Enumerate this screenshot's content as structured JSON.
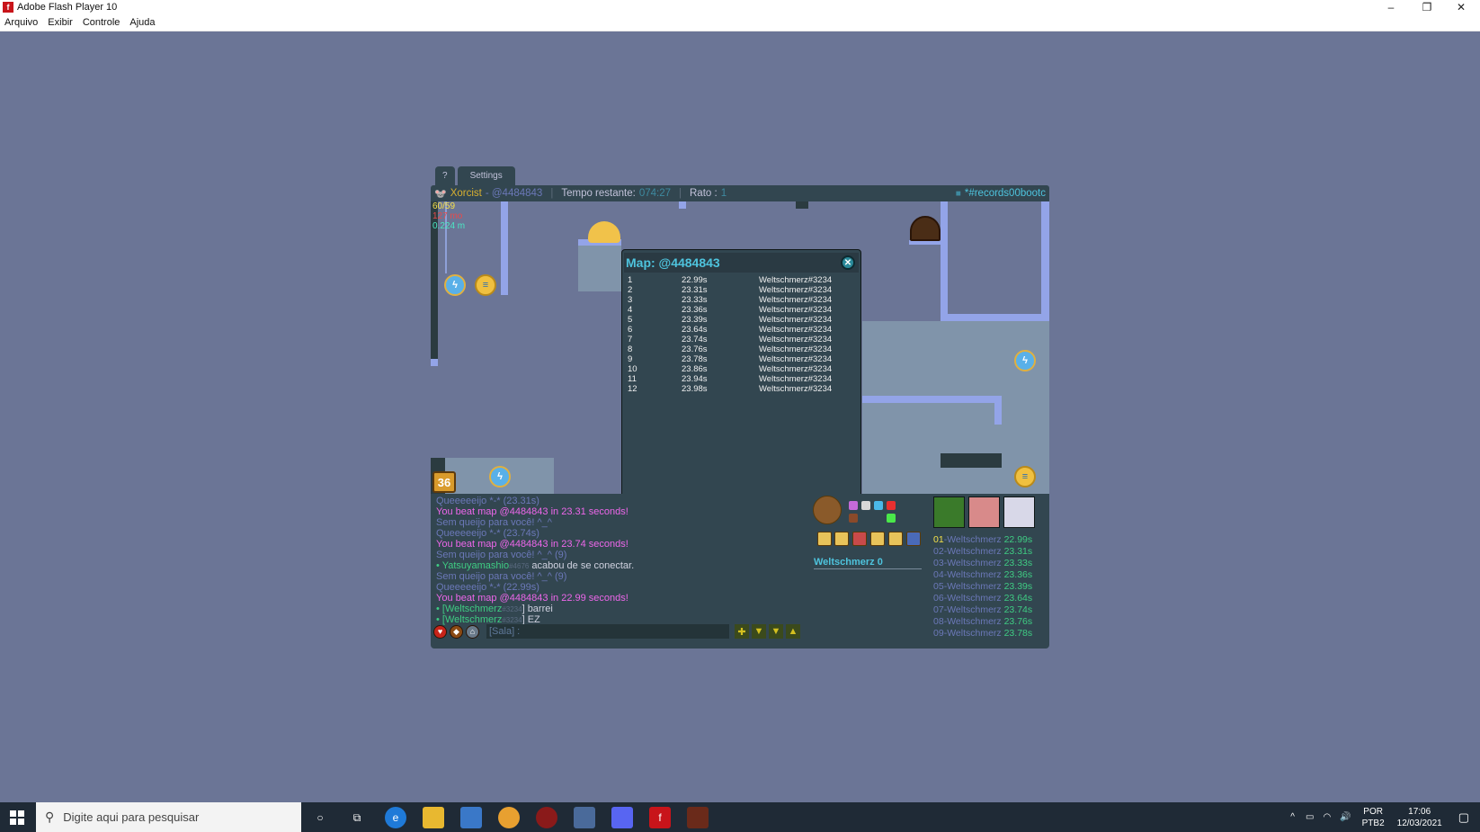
{
  "window": {
    "title": "Adobe Flash Player 10",
    "controls": {
      "minimize": "–",
      "restore": "❐",
      "close": "✕"
    }
  },
  "menu": [
    "Arquivo",
    "Exibir",
    "Controle",
    "Ajuda"
  ],
  "tabs": {
    "help": "?",
    "settings": "Settings"
  },
  "topbar": {
    "author": "Xorcist",
    "map_code": "- @4484843",
    "time_label": "Tempo restante:",
    "time_value": "074:27",
    "mice_label": "Rato :",
    "mice_value": "1",
    "room": "*#records00bootc"
  },
  "stats": {
    "line1": "60/59",
    "line2": "127 mo",
    "line3": "0.224 m"
  },
  "badge": "36",
  "popup": {
    "title": "Map: @4484843",
    "close": "✕",
    "records": [
      {
        "rank": "1",
        "time": "22.99s",
        "player": "Weltschmerz#3234"
      },
      {
        "rank": "2",
        "time": "23.31s",
        "player": "Weltschmerz#3234"
      },
      {
        "rank": "3",
        "time": "23.33s",
        "player": "Weltschmerz#3234"
      },
      {
        "rank": "4",
        "time": "23.36s",
        "player": "Weltschmerz#3234"
      },
      {
        "rank": "5",
        "time": "23.39s",
        "player": "Weltschmerz#3234"
      },
      {
        "rank": "6",
        "time": "23.64s",
        "player": "Weltschmerz#3234"
      },
      {
        "rank": "7",
        "time": "23.74s",
        "player": "Weltschmerz#3234"
      },
      {
        "rank": "8",
        "time": "23.76s",
        "player": "Weltschmerz#3234"
      },
      {
        "rank": "9",
        "time": "23.78s",
        "player": "Weltschmerz#3234"
      },
      {
        "rank": "10",
        "time": "23.86s",
        "player": "Weltschmerz#3234"
      },
      {
        "rank": "11",
        "time": "23.94s",
        "player": "Weltschmerz#3234"
      },
      {
        "rank": "12",
        "time": "23.98s",
        "player": "Weltschmerz#3234"
      }
    ]
  },
  "chat": [
    {
      "text": "Queeeeeijo *-* (23.31s)",
      "color": "grey"
    },
    {
      "text": "You beat map @4484843 in 23.31 seconds!",
      "color": "pink"
    },
    {
      "text": "Sem queijo para você! ^_^",
      "color": "grey"
    },
    {
      "text": "Queeeeeijo *-* (23.74s)",
      "color": "grey"
    },
    {
      "text": "You beat map @4484843 in 23.74 seconds!",
      "color": "pink"
    },
    {
      "text": "Sem queijo para você! ^_^ (9)",
      "color": "grey"
    },
    {
      "text": "• Yatsuyamashio",
      "extra": "#4676",
      "tail": " acabou de se conectar.",
      "color": "green"
    },
    {
      "text": "Sem queijo para você! ^_^ (9)",
      "color": "grey"
    },
    {
      "text": "Queeeeeijo *-* (22.99s)",
      "color": "grey"
    },
    {
      "text": "You beat map @4484843 in 22.99 seconds!",
      "color": "pink"
    },
    {
      "text": "• [Weltschmerz",
      "extra": "#3234",
      "tail": "] barrei",
      "color": "green"
    },
    {
      "text": "• [Weltschmerz",
      "extra": "#3234",
      "tail": "] EZ",
      "color": "green"
    }
  ],
  "chat_input": {
    "placeholder": "[Sala] :"
  },
  "player": {
    "name": "Weltschmerz",
    "score": "0"
  },
  "ranking": [
    {
      "pos": "01",
      "name": "Weltschmerz",
      "time": "22.99s"
    },
    {
      "pos": "02",
      "name": "Weltschmerz",
      "time": "23.31s"
    },
    {
      "pos": "03",
      "name": "Weltschmerz",
      "time": "23.33s"
    },
    {
      "pos": "04",
      "name": "Weltschmerz",
      "time": "23.36s"
    },
    {
      "pos": "05",
      "name": "Weltschmerz",
      "time": "23.39s"
    },
    {
      "pos": "06",
      "name": "Weltschmerz",
      "time": "23.64s"
    },
    {
      "pos": "07",
      "name": "Weltschmerz",
      "time": "23.74s"
    },
    {
      "pos": "08",
      "name": "Weltschmerz",
      "time": "23.76s"
    },
    {
      "pos": "09",
      "name": "Weltschmerz",
      "time": "23.78s"
    }
  ],
  "taskbar": {
    "search_placeholder": "Digite aqui para pesquisar",
    "lang1": "POR",
    "lang2": "PTB2",
    "time": "17:06",
    "date": "12/03/2021"
  }
}
